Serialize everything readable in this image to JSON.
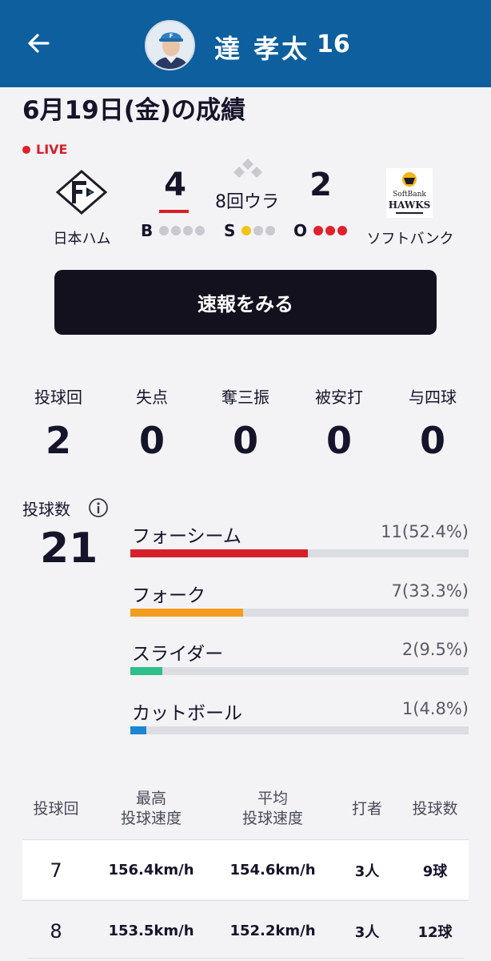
{
  "header": {
    "player_name": "達 孝太",
    "player_number": "16",
    "back_icon": "back-arrow-icon"
  },
  "game": {
    "date_title": "6月19日(金)の成績",
    "live_label": "LIVE",
    "home_team": "日本ハム",
    "away_team": "ソフトバンク",
    "away_logo_text_top": "SoftBank",
    "away_logo_text_bottom": "HAWKS",
    "home_score": "4",
    "away_score": "2",
    "inning": "8回ウラ",
    "count": {
      "balls_label": "B",
      "balls": 0,
      "balls_max": 4,
      "strikes_label": "S",
      "strikes": 1,
      "strikes_max": 3,
      "outs_label": "O",
      "outs": 3,
      "outs_max": 3
    },
    "accent_color": "#d6202a"
  },
  "report_button_label": "速報をみる",
  "summary_stats": [
    {
      "label": "投球回",
      "value": "2"
    },
    {
      "label": "失点",
      "value": "0"
    },
    {
      "label": "奪三振",
      "value": "0"
    },
    {
      "label": "被安打",
      "value": "0"
    },
    {
      "label": "与四球",
      "value": "0"
    }
  ],
  "pitch_count": {
    "label": "投球数",
    "value": "21",
    "info_icon": "info-icon"
  },
  "pitch_types": [
    {
      "name": "フォーシーム",
      "stat": "11(52.4%)",
      "fraction": 0.524,
      "color": "#d61f2c"
    },
    {
      "name": "フォーク",
      "stat": "7(33.3%)",
      "fraction": 0.333,
      "color": "#f39c1e"
    },
    {
      "name": "スライダー",
      "stat": "2(9.5%)",
      "fraction": 0.095,
      "color": "#2fbf8a"
    },
    {
      "name": "カットボール",
      "stat": "1(4.8%)",
      "fraction": 0.048,
      "color": "#1c86d1"
    }
  ],
  "inning_table": {
    "headers": [
      "投球回",
      "最高\n投球速度",
      "平均\n投球速度",
      "打者",
      "投球数"
    ],
    "rows": [
      [
        "7",
        "156.4km/h",
        "154.6km/h",
        "3人",
        "9球"
      ],
      [
        "8",
        "153.5km/h",
        "152.2km/h",
        "3人",
        "12球"
      ]
    ]
  },
  "theme": {
    "header_bg": "#0d5f9e",
    "button_bg": "#14111f",
    "page_bg": "#f3f3f6"
  }
}
